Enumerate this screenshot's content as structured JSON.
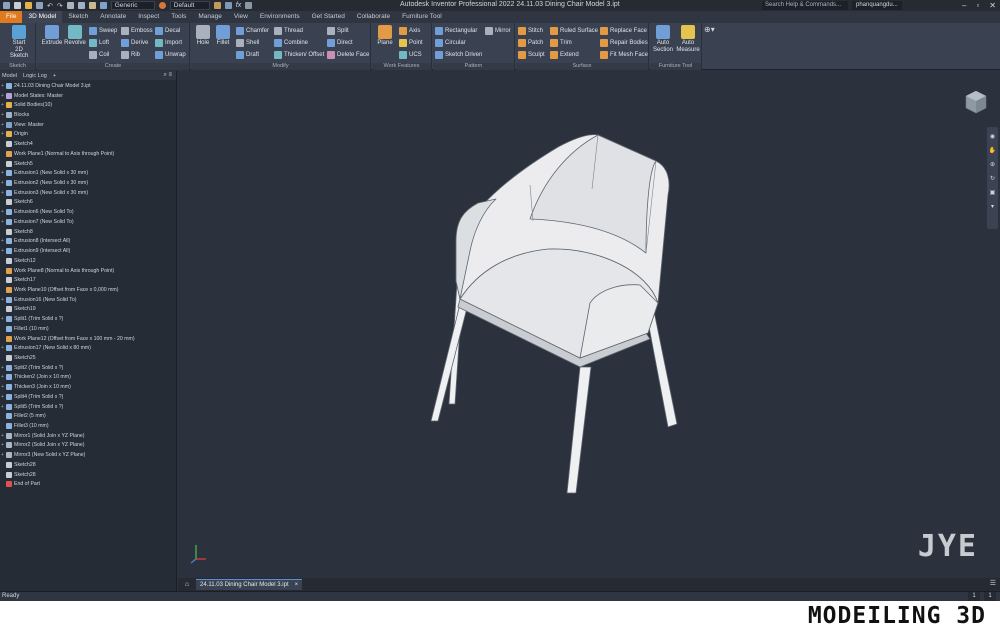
{
  "titlebar": {
    "title": "Autodesk Inventor Professional 2022    24.11.03 Dining Chair Model 3.ipt",
    "appearance_dropdown": "Generic",
    "material_dropdown": "Default",
    "search_placeholder": "Search Help & Commands...",
    "user": "phanquangdu...",
    "fx_label": "fx"
  },
  "ribbon_tabs": [
    "File",
    "3D Model",
    "Sketch",
    "Annotate",
    "Inspect",
    "Tools",
    "Manage",
    "View",
    "Environments",
    "Get Started",
    "Collaborate",
    "Furniture Tool"
  ],
  "ribbon": {
    "sketch": {
      "label": "Sketch",
      "start": "Start",
      "start2": "2D Sketch"
    },
    "create": {
      "label": "Create",
      "extrude": "Extrude",
      "revolve": "Revolve",
      "sweep": "Sweep",
      "loft": "Loft",
      "coil": "Coil",
      "emboss": "Emboss",
      "derive": "Derive",
      "rib": "Rib",
      "decal": "Decal",
      "import": "Import",
      "unwrap": "Unwrap"
    },
    "modify": {
      "label": "Modify",
      "hole": "Hole",
      "fillet": "Fillet",
      "chamfer": "Chamfer",
      "shell": "Shell",
      "draft": "Draft",
      "thread": "Thread",
      "combine": "Combine",
      "thicken": "Thicken/ Offset",
      "split": "Split",
      "direct": "Direct",
      "delete_face": "Delete Face"
    },
    "work_features": {
      "label": "Work Features",
      "plane": "Plane",
      "axis": "Axis",
      "point": "Point",
      "ucs": "UCS"
    },
    "pattern": {
      "label": "Pattern",
      "rectangular": "Rectangular",
      "circular": "Circular",
      "sketch_driven": "Sketch Driven",
      "mirror": "Mirror"
    },
    "surface": {
      "label": "Surface",
      "stitch": "Stitch",
      "patch": "Patch",
      "sculpt": "Sculpt",
      "ruled": "Ruled Surface",
      "trim": "Trim",
      "extend": "Extend",
      "replace": "Replace Face",
      "repair": "Repair Bodies",
      "fit_mesh": "Fit Mesh Face"
    },
    "furniture": {
      "label": "Furniture Tool",
      "auto_section": "Auto Section",
      "auto_measure": "Auto Measure"
    }
  },
  "browser": {
    "tab_model": "Model",
    "tab_log": "Logic Log",
    "add_icon": "+",
    "tree": [
      "24.11.03 Dining Chair Model 3.ipt",
      "Model States: Master",
      "Solid Bodies(10)",
      "Blocks",
      "View: Master",
      "Origin",
      "Sketch4",
      "Work Plane1 (Normal to Axis through Point)",
      "Sketch5",
      "Extrusion1 (New Solid x 30 mm)",
      "Extrusion2 (New Solid x 30 mm)",
      "Extrusion3 (New Solid x 30 mm)",
      "Sketch6",
      "Extrusion6 (New Solid To)",
      "Extrusion7 (New Solid To)",
      "Sketch8",
      "Extrusion8 (Intersect All)",
      "Extrusion9 (Intersect All)",
      "Sketch12",
      "Work Plane8 (Normal to Axis through Point)",
      "Sketch17",
      "Work Plane10 (Offset from Face x 0,000 mm)",
      "Extrusion16 (New Solid To)",
      "Sketch19",
      "Split1 (Trim Solid x ?)",
      "Fillet1 (10 mm)",
      "Work Plane12 (Offset from Face x 100 mm - 20 mm)",
      "Extrusion17 (New Solid x 80 mm)",
      "Sketch25",
      "Split2 (Trim Solid x ?)",
      "Thicken2 (Join x 10 mm)",
      "Thicken3 (Join x 10 mm)",
      "Split4 (Trim Solid x ?)",
      "Split5 (Trim Solid x ?)",
      "Fillet2 (5 mm)",
      "Fillet3 (10 mm)",
      "Mirror1 (Solid Join x YZ Plane)",
      "Mirror2 (Solid Join x YZ Plane)",
      "Mirror3 (New Solid x YZ Plane)",
      "Sketch28",
      "Sketch28",
      "End of Part"
    ]
  },
  "viewport": {
    "watermark": "JYE"
  },
  "doc_tab": {
    "name": "24.11.03 Dining Chair Model 3.ipt",
    "close": "×"
  },
  "status": {
    "text": "Ready",
    "num1": "1",
    "num2": "1"
  },
  "band": {
    "logo": "MODEILING 3D"
  }
}
